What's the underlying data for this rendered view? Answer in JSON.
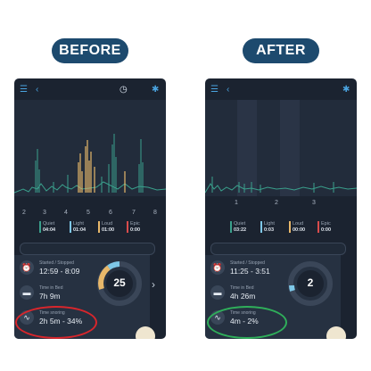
{
  "labels": {
    "before": "BEFORE",
    "after": "AFTER"
  },
  "before": {
    "x_ticks": [
      "2",
      "3",
      "4",
      "5",
      "6",
      "7",
      "8"
    ],
    "legend": [
      {
        "label": "Quiet",
        "value": "04:04",
        "color": "#3aa08c"
      },
      {
        "label": "Light",
        "value": "01:04",
        "color": "#7ec8e8"
      },
      {
        "label": "Loud",
        "value": "01:00",
        "color": "#e8b86a"
      },
      {
        "label": "Epic",
        "value": "0:00",
        "color": "#d94c4c"
      }
    ],
    "started_label": "Started / Stopped",
    "started_value": "12:59 - 8:09",
    "bed_label": "Time in Bed",
    "bed_value": "7h 9m",
    "snore_label": "Time snoring",
    "snore_value": "2h 5m - 34%",
    "score": "25"
  },
  "after": {
    "x_ticks": [
      "1",
      "2",
      "3"
    ],
    "legend": [
      {
        "label": "Quiet",
        "value": "03:22",
        "color": "#3aa08c"
      },
      {
        "label": "Light",
        "value": "0:03",
        "color": "#7ec8e8"
      },
      {
        "label": "Loud",
        "value": "00:00",
        "color": "#e8b86a"
      },
      {
        "label": "Epic",
        "value": "0:00",
        "color": "#d94c4c"
      }
    ],
    "started_label": "Started / Stopped",
    "started_value": "11:25 - 3:51",
    "bed_label": "Time in Bed",
    "bed_value": "4h 26m",
    "snore_label": "Time snoring",
    "snore_value": "4m - 2%",
    "score": "2"
  },
  "icons": {
    "menu": "menu-icon",
    "back": "back-icon",
    "clock": "clock-icon",
    "settings": "gear-icon"
  }
}
